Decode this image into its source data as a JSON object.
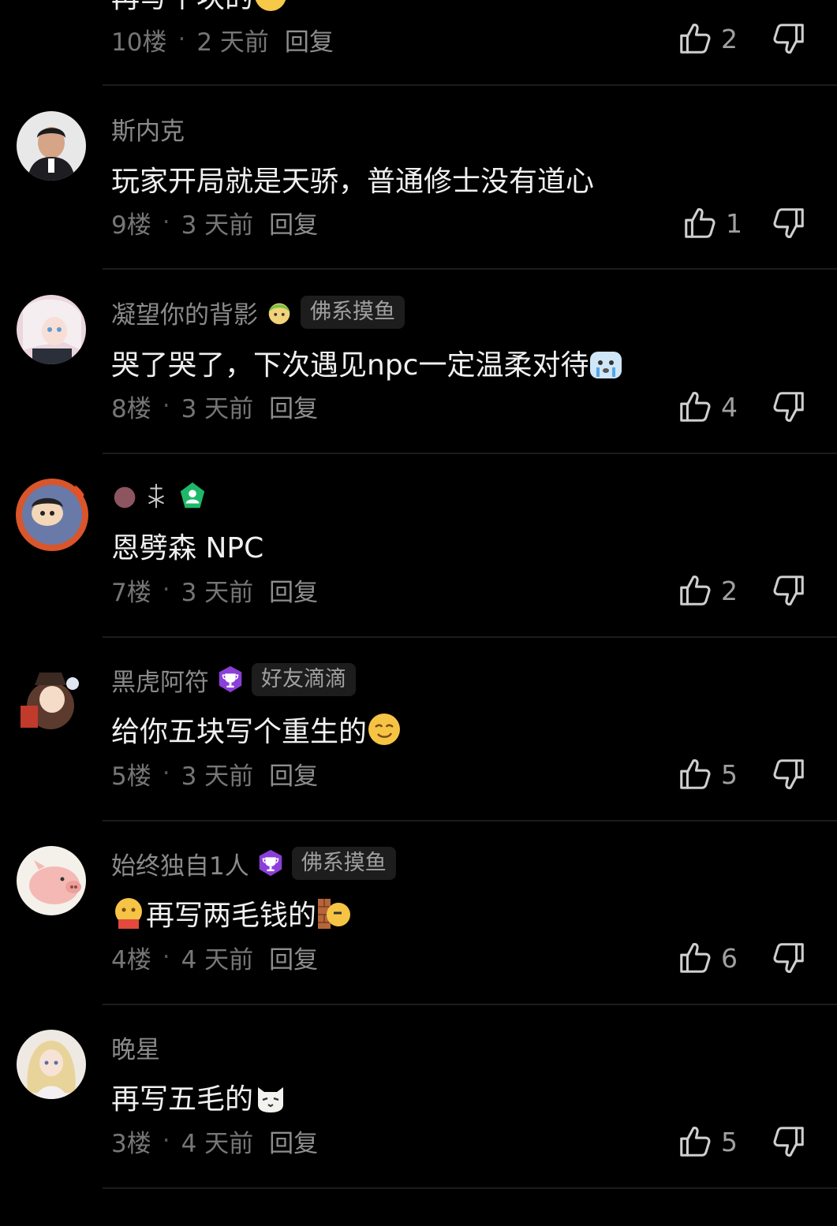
{
  "comments": [
    {
      "floor": "10楼",
      "time": "2 天前",
      "reply": "回复",
      "likes": "2",
      "body_fragment": "再写个块的"
    },
    {
      "username": "斯内克",
      "body": "玩家开局就是天骄，普通修士没有道心",
      "floor": "9楼",
      "time": "3 天前",
      "reply": "回复",
      "likes": "1"
    },
    {
      "username": "凝望你的背影",
      "tag": "佛系摸鱼",
      "body": "哭了哭了，下次遇见npc一定温柔对待",
      "floor": "8楼",
      "time": "3 天前",
      "reply": "回复",
      "likes": "4"
    },
    {
      "body": "恩劈森  NPC",
      "floor": "7楼",
      "time": "3 天前",
      "reply": "回复",
      "likes": "2"
    },
    {
      "username": "黑虎阿符",
      "tag": "好友滴滴",
      "body": "给你五块写个重生的",
      "floor": "5楼",
      "time": "3 天前",
      "reply": "回复",
      "likes": "5"
    },
    {
      "username": "始终独自1人",
      "tag": "佛系摸鱼",
      "body": "再写两毛钱的",
      "floor": "4楼",
      "time": "4 天前",
      "reply": "回复",
      "likes": "6"
    },
    {
      "username": "晚星",
      "body": "再写五毛的",
      "floor": "3楼",
      "time": "4 天前",
      "reply": "回复",
      "likes": "5"
    }
  ],
  "meta_separator": "·",
  "icons": {
    "like": "thumbs-up-icon",
    "dislike": "thumbs-down-icon",
    "badge": "trophy-badge-icon"
  },
  "colors": {
    "background": "#000000",
    "username": "#8a8a8a",
    "body": "#f0f0f0",
    "meta": "#767676",
    "badge_purple": "#8b3fd9"
  }
}
